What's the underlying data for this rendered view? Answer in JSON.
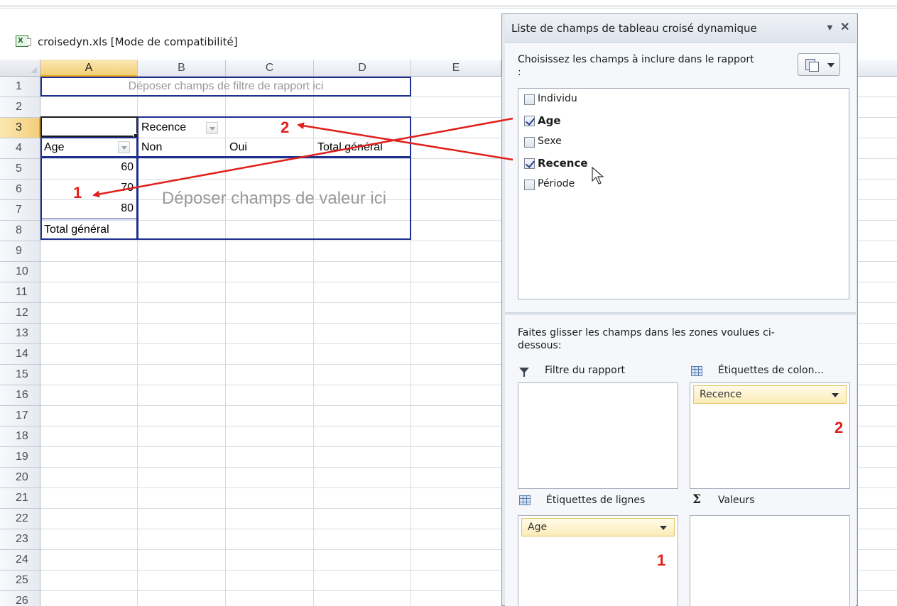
{
  "workbook": {
    "title": "croisedyn.xls  [Mode de compatibilité]",
    "icon": "excel-file-icon"
  },
  "sheet": {
    "columns": [
      "A",
      "B",
      "C",
      "D",
      "E"
    ],
    "rows": [
      "1",
      "2",
      "3",
      "4",
      "5",
      "6",
      "7",
      "8",
      "9",
      "10",
      "11",
      "12",
      "13",
      "14",
      "15",
      "16",
      "17",
      "18",
      "19",
      "20",
      "21",
      "22",
      "23",
      "24",
      "25",
      "26"
    ],
    "selected_column": "A",
    "selected_row": "3",
    "filter_drop_text": "Déposer champs de filtre de rapport ici",
    "column_field": "Recence",
    "row_field": "Age",
    "column_items": [
      "Non",
      "Oui",
      "Total général"
    ],
    "row_items": [
      "60",
      "70",
      "80"
    ],
    "grand_total_label": "Total général",
    "values_drop_text": "Déposer champs de valeur ici"
  },
  "annotations": {
    "marker_1": "1",
    "marker_2": "2",
    "arrow_color": "#e0201c"
  },
  "pane": {
    "title": "Liste de champs de tableau croisé dynamique",
    "choose_label": "Choisissez les champs à inclure dans le rapport :",
    "fields": [
      {
        "label": "Individu",
        "checked": false
      },
      {
        "label": "Age",
        "checked": true
      },
      {
        "label": "Sexe",
        "checked": false
      },
      {
        "label": "Recence",
        "checked": true
      },
      {
        "label": "Période",
        "checked": false
      }
    ],
    "drag_label": "Faites glisser les champs dans les zones voulues ci-dessous:",
    "areas": {
      "report_filter": "Filtre du rapport",
      "column_labels": "Étiquettes de colon...",
      "row_labels": "Étiquettes de lignes",
      "values": "Valeurs"
    },
    "column_area_item": "Recence",
    "row_area_item": "Age"
  }
}
